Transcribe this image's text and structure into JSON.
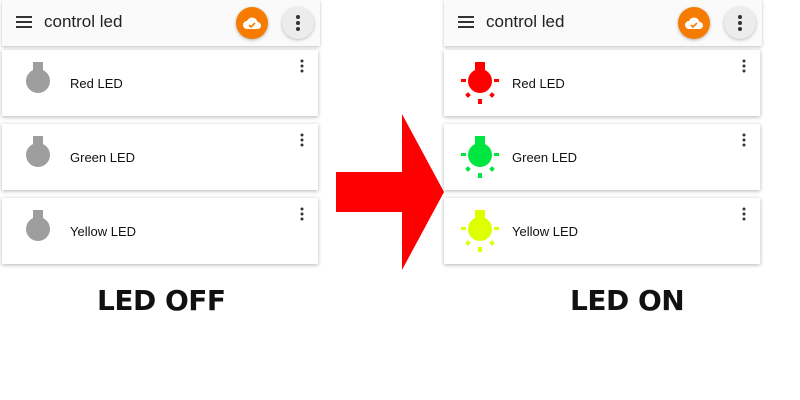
{
  "panels": {
    "off": {
      "title": "control led",
      "leds": [
        {
          "label": "Red LED",
          "color": "#9e9e9e",
          "on": false
        },
        {
          "label": "Green LED",
          "color": "#9e9e9e",
          "on": false
        },
        {
          "label": "Yellow LED",
          "color": "#9e9e9e",
          "on": false
        }
      ],
      "caption": "LED OFF"
    },
    "on": {
      "title": "control led",
      "leds": [
        {
          "label": "Red LED",
          "color": "#ff0000",
          "on": true
        },
        {
          "label": "Green LED",
          "color": "#00e640",
          "on": true
        },
        {
          "label": "Yellow LED",
          "color": "#ddff00",
          "on": true
        }
      ],
      "caption": "LED ON"
    }
  },
  "colors": {
    "accent": "#f57c00",
    "arrow": "#ff0000",
    "led_off": "#9e9e9e"
  },
  "icons": {
    "menu": "menu-icon",
    "cloud": "cloud-done-icon",
    "more": "more-vert-icon",
    "bulb": "lightbulb-icon",
    "arrow": "arrow-right-icon"
  }
}
